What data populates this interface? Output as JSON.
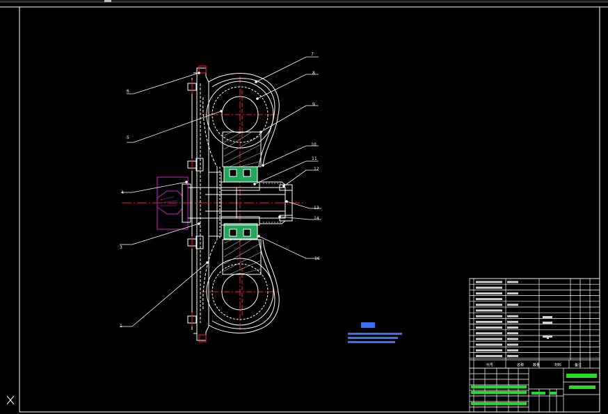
{
  "colors": {
    "background": "#000000",
    "frame": "#ffffff",
    "centerline": "#ff2020",
    "hatch_green": "#21a65a",
    "magenta": "#d020d0",
    "leader": "#ffffff",
    "tech_note_blue": "#3a6cff",
    "title_green": "#22dd22"
  },
  "part_labels": [
    "1",
    "3",
    "4",
    "5",
    "6",
    "7",
    "8",
    "9",
    "10",
    "11",
    "12",
    "13",
    "14",
    "16"
  ],
  "ucs_icon": "ucs-icon",
  "tech_note": {
    "heading_illegible": true
  },
  "title_block": {
    "header_codes": [
      "代号",
      "名称",
      "数量",
      "材料",
      "备注"
    ]
  }
}
